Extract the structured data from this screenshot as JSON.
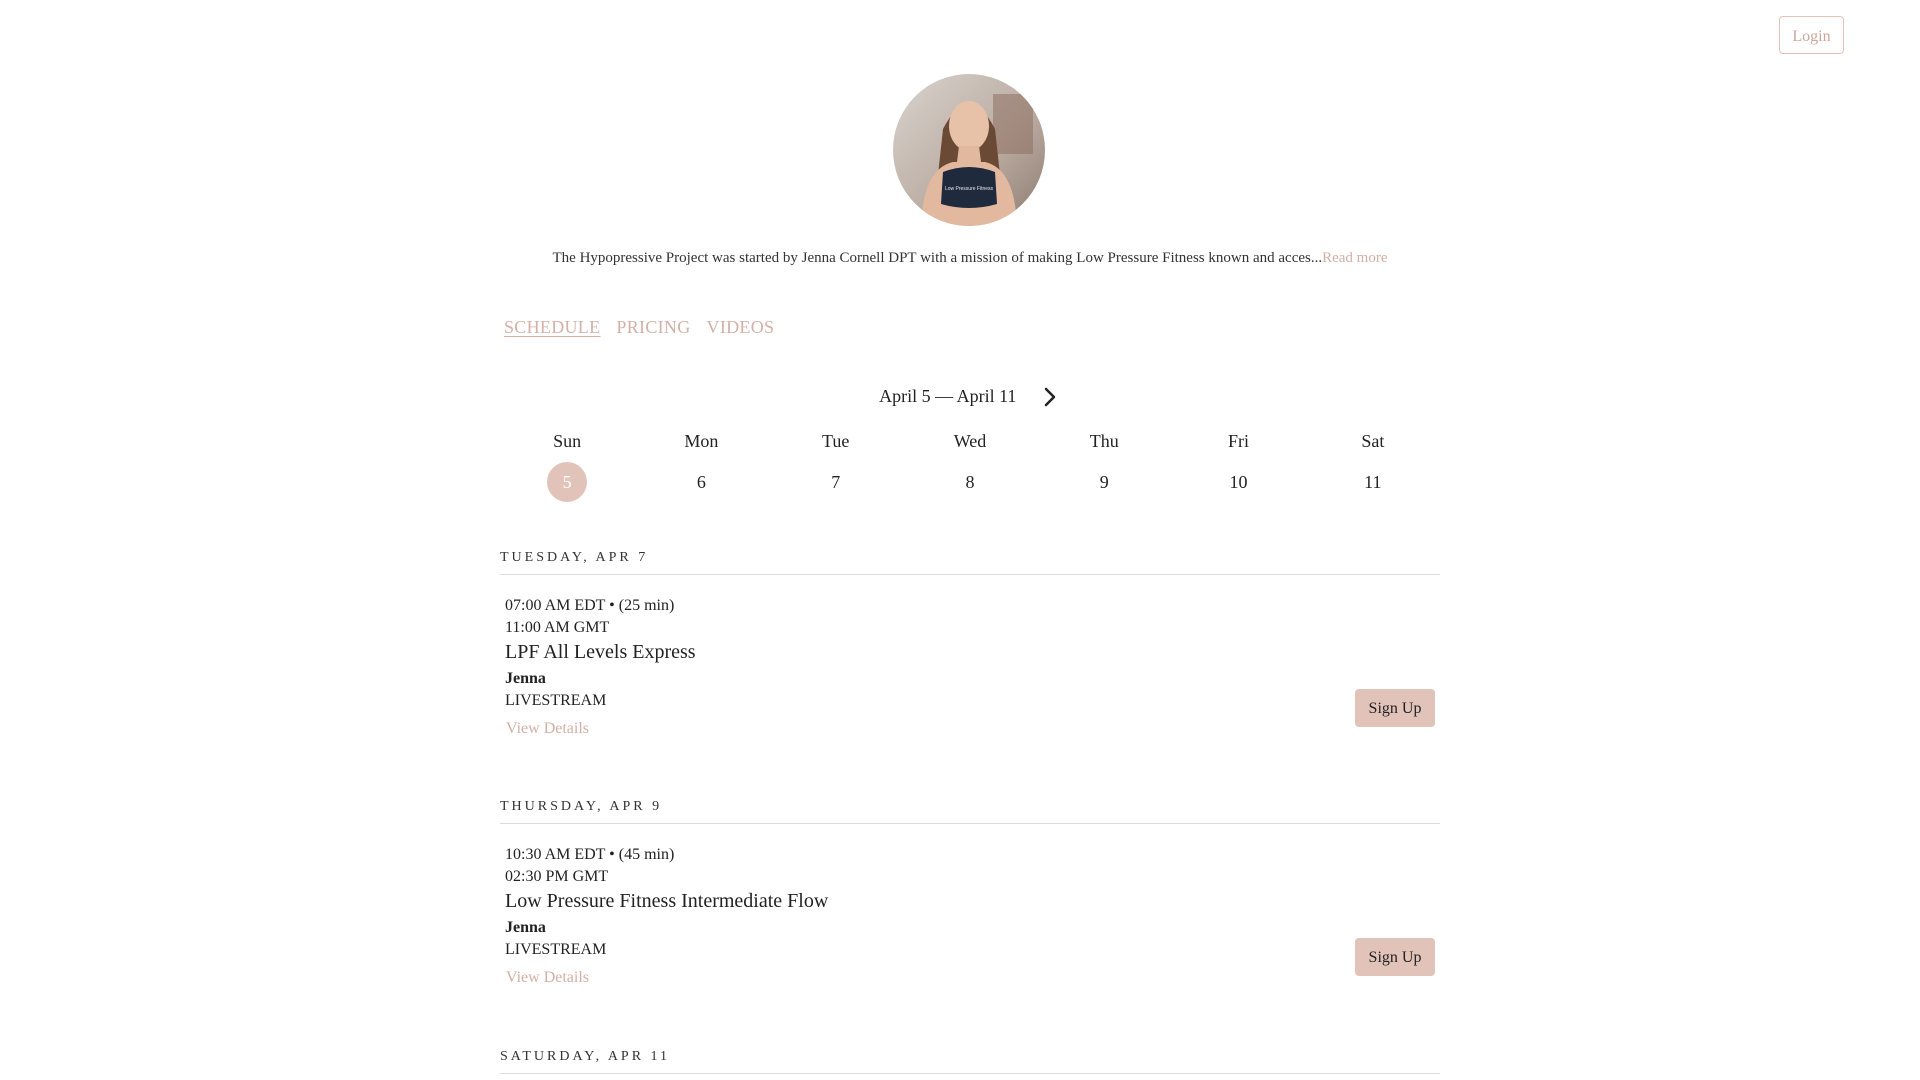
{
  "header": {
    "login_label": "Login"
  },
  "profile": {
    "bio": "The Hypopressive Project was started by Jenna Cornell DPT with a mission of making Low Pressure Fitness known and acces...",
    "read_more": "Read more",
    "shirt_text": "Low Pressure Fitness"
  },
  "tabs": [
    {
      "label": "SCHEDULE",
      "active": true
    },
    {
      "label": "PRICING",
      "active": false
    },
    {
      "label": "VIDEOS",
      "active": false
    }
  ],
  "week": {
    "range": "April 5 — April 11",
    "days": [
      {
        "name": "Sun",
        "num": "5",
        "selected": true
      },
      {
        "name": "Mon",
        "num": "6",
        "selected": false
      },
      {
        "name": "Tue",
        "num": "7",
        "selected": false
      },
      {
        "name": "Wed",
        "num": "8",
        "selected": false
      },
      {
        "name": "Thu",
        "num": "9",
        "selected": false
      },
      {
        "name": "Fri",
        "num": "10",
        "selected": false
      },
      {
        "name": "Sat",
        "num": "11",
        "selected": false
      }
    ]
  },
  "schedule": [
    {
      "date_heading": "TUESDAY, APR 7",
      "classes": [
        {
          "time_local": "07:00 AM EDT • (25 min)",
          "time_gmt": "11:00 AM GMT",
          "title": "LPF All Levels Express",
          "instructor": "Jenna",
          "location": "LIVESTREAM",
          "details_label": "View Details",
          "signup_label": "Sign Up"
        }
      ]
    },
    {
      "date_heading": "THURSDAY, APR 9",
      "classes": [
        {
          "time_local": "10:30 AM EDT • (45 min)",
          "time_gmt": "02:30 PM GMT",
          "title": "Low Pressure Fitness Intermediate Flow",
          "instructor": "Jenna",
          "location": "LIVESTREAM",
          "details_label": "View Details",
          "signup_label": "Sign Up"
        }
      ]
    },
    {
      "date_heading": "SATURDAY, APR 11",
      "classes": []
    }
  ],
  "colors": {
    "accent": "#e2c3b9",
    "link": "#d2afa5"
  }
}
